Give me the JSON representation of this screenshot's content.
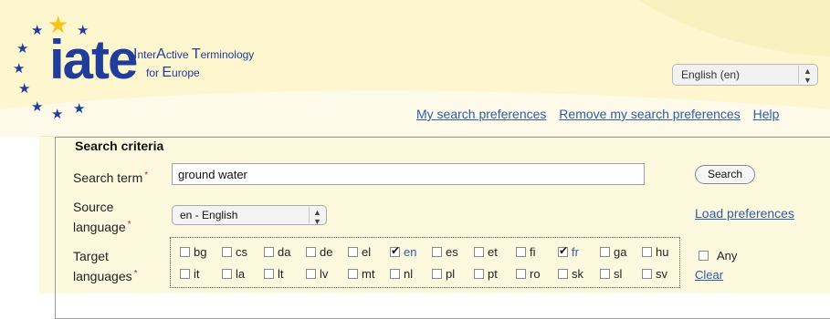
{
  "header": {
    "logo_text": "iate",
    "tagline": {
      "line1": [
        {
          "cap": "I",
          "rest": "nter"
        },
        {
          "cap": "A",
          "rest": "ctive "
        },
        {
          "cap": "T",
          "rest": "erminology"
        }
      ],
      "line2_prefix": "for ",
      "line2": [
        {
          "cap": "E",
          "rest": "urope"
        }
      ]
    },
    "language_select": {
      "value": "English (en)"
    }
  },
  "pref_links": {
    "my_prefs": "My search preferences",
    "remove_prefs": "Remove my search preferences",
    "help": "Help"
  },
  "criteria": {
    "legend": "Search criteria",
    "search_term_label": "Search term",
    "search_term_value": "ground water",
    "search_button": "Search",
    "source_label_line1": "Source",
    "source_label_line2": "language",
    "source_value": "en - English",
    "load_prefs": "Load preferences",
    "target_label_line1": "Target",
    "target_label_line2": "languages",
    "any_label": "Any",
    "clear_link": "Clear",
    "target_languages_row1": [
      {
        "code": "bg",
        "checked": false
      },
      {
        "code": "cs",
        "checked": false
      },
      {
        "code": "da",
        "checked": false
      },
      {
        "code": "de",
        "checked": false
      },
      {
        "code": "el",
        "checked": false
      },
      {
        "code": "en",
        "checked": true
      },
      {
        "code": "es",
        "checked": false
      },
      {
        "code": "et",
        "checked": false
      },
      {
        "code": "fi",
        "checked": false
      },
      {
        "code": "fr",
        "checked": true
      },
      {
        "code": "ga",
        "checked": false
      },
      {
        "code": "hu",
        "checked": false
      }
    ],
    "target_languages_row2": [
      {
        "code": "it",
        "checked": false
      },
      {
        "code": "la",
        "checked": false
      },
      {
        "code": "lt",
        "checked": false
      },
      {
        "code": "lv",
        "checked": false
      },
      {
        "code": "mt",
        "checked": false
      },
      {
        "code": "nl",
        "checked": false
      },
      {
        "code": "pl",
        "checked": false
      },
      {
        "code": "pt",
        "checked": false
      },
      {
        "code": "ro",
        "checked": false
      },
      {
        "code": "sk",
        "checked": false
      },
      {
        "code": "sl",
        "checked": false
      },
      {
        "code": "sv",
        "checked": false
      }
    ]
  },
  "colors": {
    "header_bg": "#fdf6cf",
    "brand_blue": "#1f3d99",
    "star_gold": "#f5c518",
    "link_blue": "#2f5ca8",
    "required_red": "#d32020"
  }
}
